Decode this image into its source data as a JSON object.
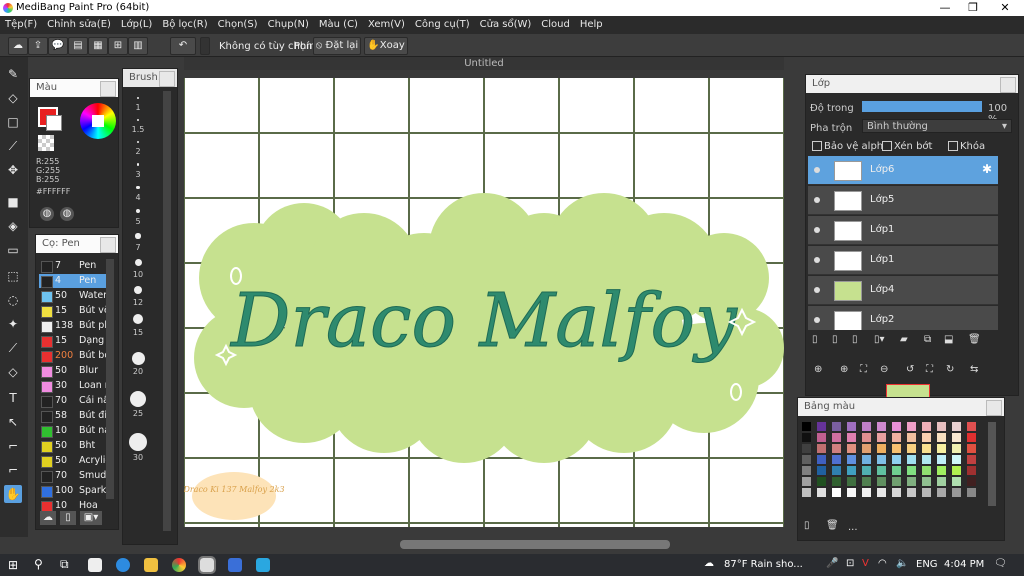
{
  "window": {
    "title": "MediBang Paint Pro (64bit)"
  },
  "menu": [
    "Tệp(F)",
    "Chỉnh sửa(E)",
    "Lớp(L)",
    "Bộ lọc(R)",
    "Chọn(S)",
    "Chụp(N)",
    "Màu (C)",
    "Xem(V)",
    "Công cụ(T)",
    "Cửa sổ(W)",
    "Cloud",
    "Help"
  ],
  "toolbar": {
    "no_options": "Không có tùy chọn",
    "keys_label": "Phím",
    "reset_label": "Đặt lại",
    "rotate_label": "Xoay"
  },
  "document": {
    "tab_title": "Untitled"
  },
  "color_panel": {
    "title": "Màu",
    "r": "R:255",
    "g": "G:255",
    "b": "B:255",
    "hex": "#FFFFFF"
  },
  "brush_panel": {
    "title": "Cọ: Pen",
    "items": [
      {
        "size": "7",
        "label": "Pen",
        "color": "#222222"
      },
      {
        "size": "4",
        "label": "Pen",
        "color": "#222222",
        "selected": true
      },
      {
        "size": "50",
        "label": "Water",
        "color": "#6ec3f0"
      },
      {
        "size": "15",
        "label": "Bút vẽ",
        "color": "#f0e040"
      },
      {
        "size": "138",
        "label": "Bút pha",
        "color": "#eeeeee"
      },
      {
        "size": "15",
        "label": "Dạng",
        "color": "#e83030"
      },
      {
        "size": "200",
        "label": "Bút bọt",
        "color": "#e83030",
        "orange": true
      },
      {
        "size": "50",
        "label": "Blur",
        "color": "#f08ce0"
      },
      {
        "size": "30",
        "label": "Loan m",
        "color": "#f08ce0"
      },
      {
        "size": "70",
        "label": "Cái nắ",
        "color": "#222222"
      },
      {
        "size": "58",
        "label": "Bút đi",
        "color": "#222222"
      },
      {
        "size": "10",
        "label": "Bút nả",
        "color": "#30c030"
      },
      {
        "size": "50",
        "label": "Bht",
        "color": "#e0d020"
      },
      {
        "size": "50",
        "label": "Acrylic",
        "color": "#e0d020"
      },
      {
        "size": "70",
        "label": "Smudg",
        "color": "#222222"
      },
      {
        "size": "100",
        "label": "Sparkl",
        "color": "#3070e0"
      },
      {
        "size": "10",
        "label": "Hoa",
        "color": "#e83030"
      }
    ]
  },
  "size_panel": {
    "title": "Brush...",
    "sizes": [
      "1",
      "1.5",
      "2",
      "3",
      "4",
      "5",
      "7",
      "10",
      "12",
      "15",
      "20",
      "25",
      "30"
    ]
  },
  "canvas_art": {
    "text": "Draco Malfoy",
    "signature": "Draco Ki 137 Malfoy 2k3",
    "blob_color": "#c6e18f",
    "grid_color": "#5a6b48",
    "text_color": "#2e8a6e"
  },
  "layer_panel": {
    "title": "Lớp",
    "opacity_label": "Độ trong",
    "opacity_value": "100 %",
    "blend_label": "Pha trộn",
    "blend_value": "Bình thường",
    "protect_alpha": "Bảo vệ alpha",
    "clipping": "Xén bớt",
    "lock": "Khóa",
    "layers": [
      "Lớp6",
      "Lớp5",
      "Lớp1",
      "Lớp1",
      "Lớp4",
      "Lớp2"
    ]
  },
  "palette_panel": {
    "title": "Bảng màu",
    "more": "..."
  },
  "taskbar": {
    "weather": "87°F  Rain sho...",
    "lang": "ENG",
    "time": "4:04 PM"
  },
  "colors": {
    "accent_blue": "#5aa0e0",
    "selected_layer": "#5ea2de"
  }
}
